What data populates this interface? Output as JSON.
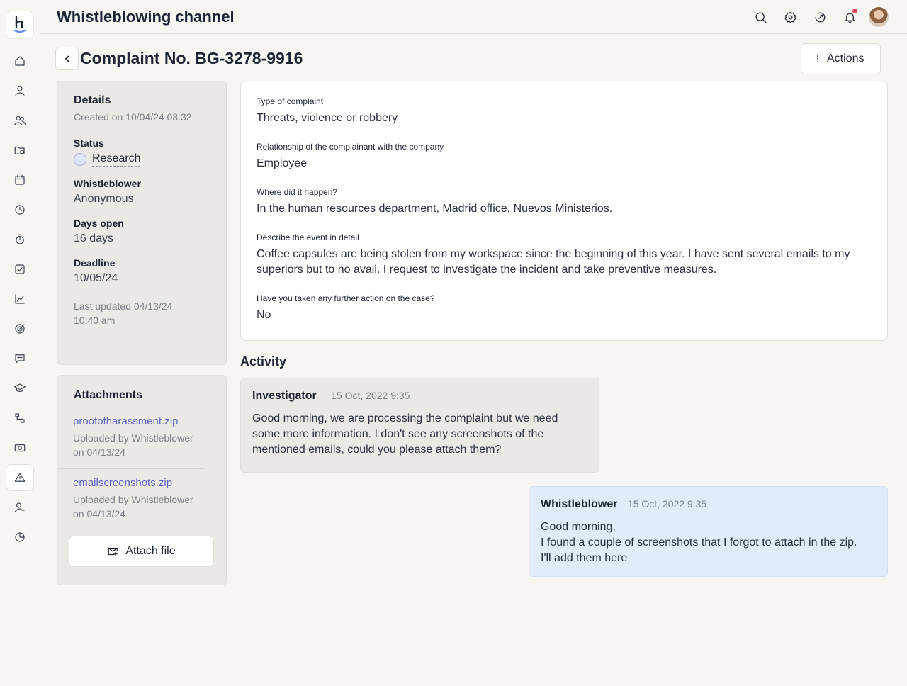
{
  "app": {
    "title": "Whistleblowing channel"
  },
  "sidebar": {
    "items": [
      {
        "icon": "home-icon"
      },
      {
        "icon": "user-icon"
      },
      {
        "icon": "users-icon"
      },
      {
        "icon": "folder-icon"
      },
      {
        "icon": "calendar-icon"
      },
      {
        "icon": "clock-icon"
      },
      {
        "icon": "timer-icon"
      },
      {
        "icon": "checkbox-icon"
      },
      {
        "icon": "chart-icon"
      },
      {
        "icon": "target-icon"
      },
      {
        "icon": "chat-icon"
      },
      {
        "icon": "graduation-icon"
      },
      {
        "icon": "workflow-icon"
      },
      {
        "icon": "money-icon"
      },
      {
        "icon": "alert-icon",
        "active": true
      },
      {
        "icon": "user-add-icon"
      },
      {
        "icon": "pie-icon"
      }
    ]
  },
  "header": {
    "icons": [
      "search-icon",
      "gear-icon",
      "rocket-icon",
      "bell-icon",
      "avatar"
    ]
  },
  "page": {
    "title": "Complaint No. BG-3278-9916",
    "actions_label": "Actions"
  },
  "details": {
    "heading": "Details",
    "created": "Created on 10/04/24 08:32",
    "status_label": "Status",
    "status_value": "Research",
    "whistleblower_label": "Whistleblower",
    "whistleblower_value": "Anonymous",
    "days_open_label": "Days open",
    "days_open_value": "16 days",
    "deadline_label": "Deadline",
    "deadline_value": "10/05/24",
    "last_updated_line1": "Last updated 04/13/24",
    "last_updated_line2": "10:40 am"
  },
  "attachments": {
    "heading": "Attachments",
    "files": [
      {
        "name": "proofofharassment.zip",
        "uploader": "Uploaded by Whistleblower",
        "date": "on 04/13/24"
      },
      {
        "name": "emailscreenshots.zip",
        "uploader": "Uploaded by Whistleblower",
        "date": "on 04/13/24"
      }
    ],
    "attach_label": "Attach file"
  },
  "complaint": {
    "q1_label": "Type of complaint",
    "q1_value": "Threats, violence or robbery",
    "q2_label": "Relationship of the complainant with the company",
    "q2_value": "Employee",
    "q3_label": "Where did it happen?",
    "q3_value": "In the human resources department, Madrid office, Nuevos Ministerios.",
    "q4_label": "Describe the event in detail",
    "q4_value_line1": "Coffee capsules are being stolen from my workspace since the beginning of this year. I have sent several emails to my",
    "q4_value_line2": "superiors but to no avail. I request to investigate the incident and take preventive measures.",
    "q5_label": "Have you taken any further action on the case?",
    "q5_value": "No"
  },
  "activity": {
    "title": "Activity",
    "messages": [
      {
        "author": "Investigator",
        "time": "15 Oct, 2022 9:35",
        "body": "Good morning, we are processing the complaint but we need\nsome more information. I don't see any screenshots of the\nmentioned emails, could you please attach them?"
      },
      {
        "author": "Whistleblower",
        "time": "15 Oct, 2022 9:35",
        "body": "Good morning,\nI found a couple of screenshots that I forgot to attach in the zip.\nI'll add them here"
      }
    ]
  }
}
